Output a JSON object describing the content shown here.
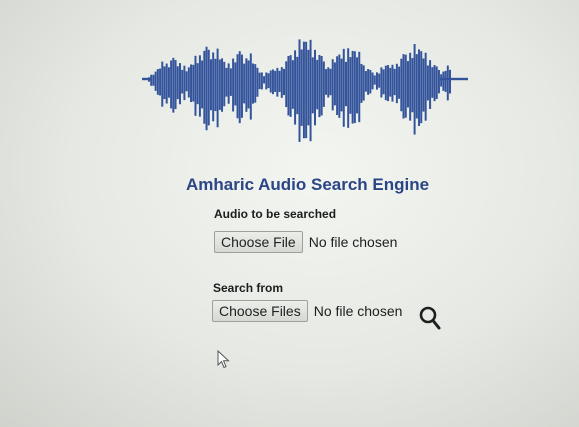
{
  "page": {
    "title": "Amharic Audio Search Engine"
  },
  "query_audio": {
    "label": "Audio to be searched",
    "button_label": "Choose File",
    "status": "No file chosen"
  },
  "search_source": {
    "label": "Search from",
    "button_label": "Choose Files",
    "status": "No file chosen"
  },
  "icons": {
    "logo": "audio-waveform-icon",
    "search": "search-icon",
    "cursor": "mouse-pointer-icon"
  },
  "colors": {
    "accent": "#2b4586",
    "waveform": "#33539b"
  }
}
